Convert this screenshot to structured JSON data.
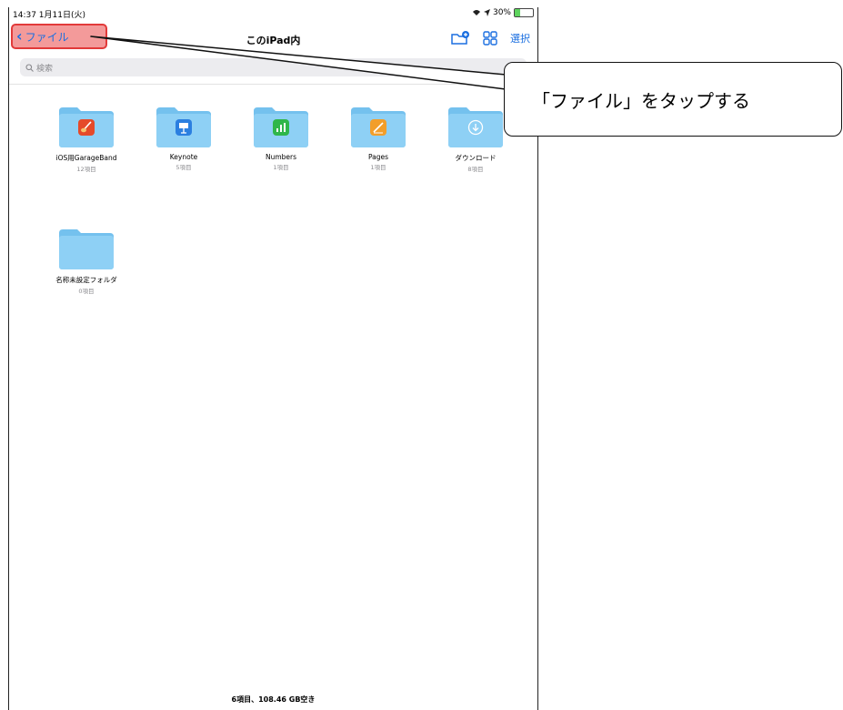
{
  "status_bar": {
    "time_date": "14:37  1月11日(火)",
    "battery": "30%",
    "battery_fraction": 0.3
  },
  "nav": {
    "back_label": "ファイル",
    "title": "このiPad内",
    "select_label": "選択"
  },
  "search": {
    "placeholder": "検索"
  },
  "items": [
    {
      "name": "iOS用GarageBand",
      "count": "12項目",
      "badge": "garageband-icon",
      "badge_color": "#e54a2a"
    },
    {
      "name": "Keynote",
      "count": "5項目",
      "badge": "keynote-icon",
      "badge_color": "#2b7fe0"
    },
    {
      "name": "Numbers",
      "count": "1項目",
      "badge": "numbers-icon",
      "badge_color": "#2fb64a"
    },
    {
      "name": "Pages",
      "count": "1項目",
      "badge": "pages-icon",
      "badge_color": "#f29e2a"
    },
    {
      "name": "ダウンロード",
      "count": "8項目",
      "badge": "download-icon",
      "badge_color": "#ffffff"
    },
    {
      "name": "名称未設定フォルダ",
      "count": "0項目",
      "badge": "",
      "badge_color": ""
    }
  ],
  "footer": {
    "text": "6項目、108.46 GB空き"
  },
  "callout": {
    "text": "「ファイル」をタップする"
  },
  "colors": {
    "accent": "#1b6fe0",
    "folder": "#8ed0f5",
    "folder_tab": "#74c1ee",
    "highlight": "#f39a9a",
    "highlight_border": "#e23a3a"
  }
}
